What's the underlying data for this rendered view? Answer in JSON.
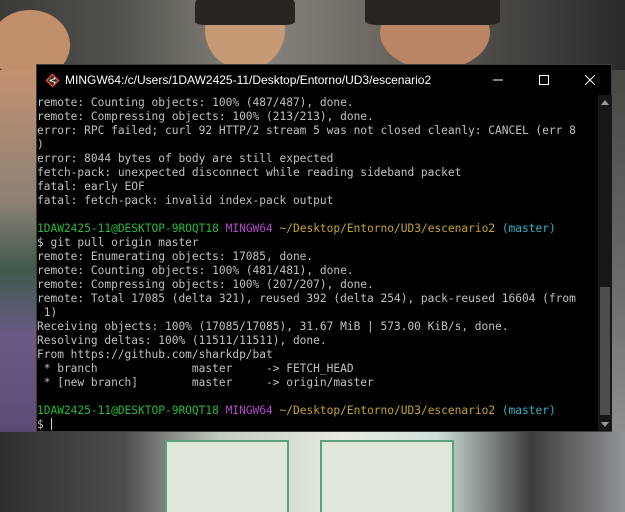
{
  "window": {
    "title": "MINGW64:/c/Users/1DAW2425-11/Desktop/Entorno/UD3/escenario2"
  },
  "terminal": {
    "lines": [
      {
        "segments": [
          {
            "text": "remote: Counting objects: 100% (487/487), done.",
            "style": "plain"
          }
        ]
      },
      {
        "segments": [
          {
            "text": "remote: Compressing objects: 100% (213/213), done.",
            "style": "plain"
          }
        ]
      },
      {
        "segments": [
          {
            "text": "error: RPC failed; curl 92 HTTP/2 stream 5 was not closed cleanly: CANCEL (err 8",
            "style": "plain"
          }
        ]
      },
      {
        "segments": [
          {
            "text": ")",
            "style": "plain"
          }
        ]
      },
      {
        "segments": [
          {
            "text": "error: 8044 bytes of body are still expected",
            "style": "plain"
          }
        ]
      },
      {
        "segments": [
          {
            "text": "fetch-pack: unexpected disconnect while reading sideband packet",
            "style": "plain"
          }
        ]
      },
      {
        "segments": [
          {
            "text": "fatal: early EOF",
            "style": "plain"
          }
        ]
      },
      {
        "segments": [
          {
            "text": "fatal: fetch-pack: invalid index-pack output",
            "style": "plain"
          }
        ]
      },
      {
        "segments": [
          {
            "text": "",
            "style": "plain"
          }
        ]
      },
      {
        "segments": [
          {
            "text": "1DAW2425-11@DESKTOP-9ROQT18",
            "style": "green"
          },
          {
            "text": " ",
            "style": "plain"
          },
          {
            "text": "MINGW64",
            "style": "magenta"
          },
          {
            "text": " ",
            "style": "plain"
          },
          {
            "text": "~/Desktop/Entorno/UD3/escenario2",
            "style": "yellow"
          },
          {
            "text": " ",
            "style": "plain"
          },
          {
            "text": "(master)",
            "style": "cyan"
          }
        ]
      },
      {
        "segments": [
          {
            "text": "$ git pull origin master",
            "style": "plain"
          }
        ]
      },
      {
        "segments": [
          {
            "text": "remote: Enumerating objects: 17085, done.",
            "style": "plain"
          }
        ]
      },
      {
        "segments": [
          {
            "text": "remote: Counting objects: 100% (481/481), done.",
            "style": "plain"
          }
        ]
      },
      {
        "segments": [
          {
            "text": "remote: Compressing objects: 100% (207/207), done.",
            "style": "plain"
          }
        ]
      },
      {
        "segments": [
          {
            "text": "remote: Total 17085 (delta 321), reused 392 (delta 254), pack-reused 16604 (from",
            "style": "plain"
          }
        ]
      },
      {
        "segments": [
          {
            "text": " 1)",
            "style": "plain"
          }
        ]
      },
      {
        "segments": [
          {
            "text": "Receiving objects: 100% (17085/17085), 31.67 MiB | 573.00 KiB/s, done.",
            "style": "plain"
          }
        ]
      },
      {
        "segments": [
          {
            "text": "Resolving deltas: 100% (11511/11511), done.",
            "style": "plain"
          }
        ]
      },
      {
        "segments": [
          {
            "text": "From https://github.com/sharkdp/bat",
            "style": "plain"
          }
        ]
      },
      {
        "segments": [
          {
            "text": " * branch              master     -> FETCH_HEAD",
            "style": "plain"
          }
        ]
      },
      {
        "segments": [
          {
            "text": " * [new branch]        master     -> origin/master",
            "style": "plain"
          }
        ]
      },
      {
        "segments": [
          {
            "text": "",
            "style": "plain"
          }
        ]
      },
      {
        "segments": [
          {
            "text": "1DAW2425-11@DESKTOP-9ROQT18",
            "style": "green"
          },
          {
            "text": " ",
            "style": "plain"
          },
          {
            "text": "MINGW64",
            "style": "magenta"
          },
          {
            "text": " ",
            "style": "plain"
          },
          {
            "text": "~/Desktop/Entorno/UD3/escenario2",
            "style": "yellow"
          },
          {
            "text": " ",
            "style": "plain"
          },
          {
            "text": "(master)",
            "style": "cyan"
          }
        ]
      }
    ],
    "prompt_symbol": "$"
  },
  "icons": {
    "app": "git-bash-icon",
    "minimize": "minimize-icon",
    "maximize": "maximize-icon",
    "close": "close-icon",
    "scroll_up": "scroll-up-icon",
    "scroll_down": "scroll-down-icon"
  },
  "colors": {
    "terminal_bg": "#000000",
    "text": "#c0c0c0",
    "user_host": "#23bc3c",
    "mingw": "#b148c6",
    "path": "#c3a626",
    "branch": "#2fb4c6"
  }
}
